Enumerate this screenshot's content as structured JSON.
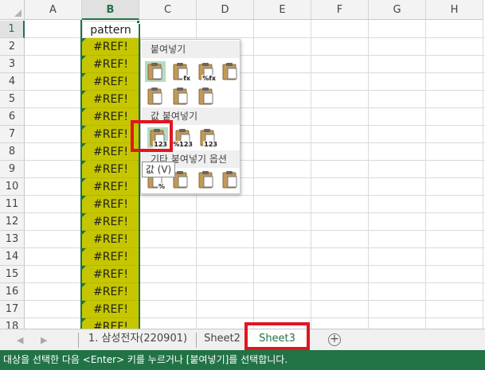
{
  "grid": {
    "columns": [
      "A",
      "B",
      "C",
      "D",
      "E",
      "F",
      "G",
      "H"
    ],
    "selected_column": "B",
    "rows": [
      "1",
      "2",
      "3",
      "4",
      "5",
      "6",
      "7",
      "8",
      "9",
      "10",
      "11",
      "12",
      "13",
      "14",
      "15",
      "16",
      "17",
      "18"
    ],
    "selected_row": "1",
    "column_b_cells": [
      "pattern",
      "#REF!",
      "#REF!",
      "#REF!",
      "#REF!",
      "#REF!",
      "#REF!",
      "#REF!",
      "#REF!",
      "#REF!",
      "#REF!",
      "#REF!",
      "#REF!",
      "#REF!",
      "#REF!",
      "#REF!",
      "#REF!",
      "#REF!"
    ]
  },
  "paste_menu": {
    "sections": [
      {
        "label": "붙여넣기",
        "buttons": [
          {
            "name": "paste",
            "sub": ""
          },
          {
            "name": "formulas",
            "sub": "fx"
          },
          {
            "name": "formulas-number-formatting",
            "sub": "%fx"
          },
          {
            "name": "keep-source-formatting",
            "sub": ""
          },
          {
            "name": "no-borders",
            "sub": ""
          },
          {
            "name": "keep-source-column-widths",
            "sub": ""
          },
          {
            "name": "transpose",
            "sub": ""
          }
        ]
      },
      {
        "label": "값 붙여넣기",
        "buttons": [
          {
            "name": "values",
            "sub": "123"
          },
          {
            "name": "values-number-formatting",
            "sub": "%123"
          },
          {
            "name": "values-source-formatting",
            "sub": "123"
          }
        ]
      },
      {
        "label": "기타 붙여넣기 옵션",
        "buttons": [
          {
            "name": "formatting",
            "sub": "%"
          },
          {
            "name": "paste-link",
            "sub": ""
          },
          {
            "name": "picture",
            "sub": ""
          },
          {
            "name": "linked-picture",
            "sub": ""
          }
        ]
      }
    ],
    "tooltip": "값 (V)"
  },
  "sheet_tabs": {
    "tabs": [
      "1. 삼성전자(220901)",
      "Sheet2",
      "Sheet3"
    ],
    "active": "Sheet3",
    "add_symbol": "+"
  },
  "status_bar": {
    "text": "대상을 선택한 다음 <Enter> 키를 누르거나 [붙여넣기]를 선택합니다."
  },
  "colors": {
    "excel_green": "#217346",
    "error_fill": "#c6c600",
    "annotation_red": "#e0161f",
    "menu_hover": "#b6dbc2"
  }
}
